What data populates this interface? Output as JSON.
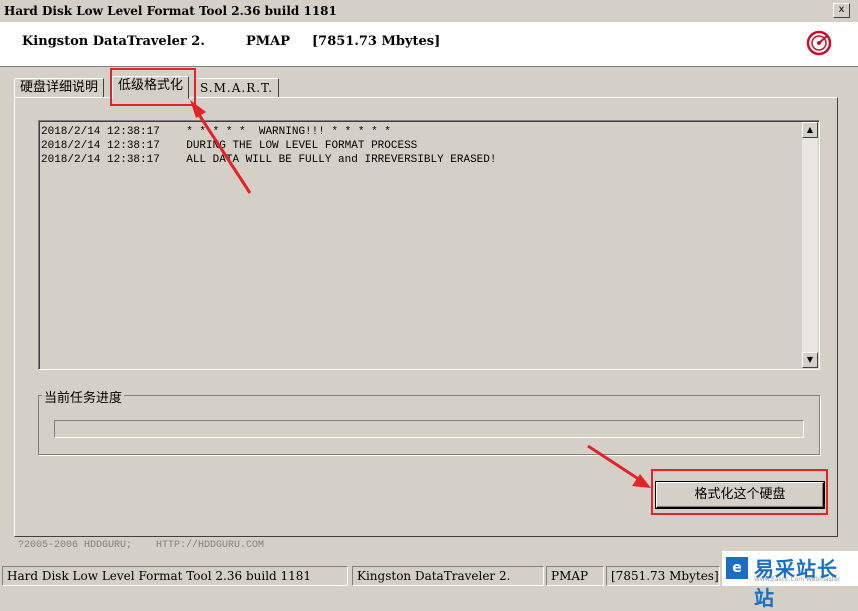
{
  "window": {
    "title": "Hard Disk Low Level Format Tool 2.36 build 1181",
    "close_glyph": "x"
  },
  "header": {
    "device": "Kingston DataTraveler 2.",
    "mode": "PMAP",
    "size": "[7851.73 Mbytes]"
  },
  "tabs": [
    {
      "label": "硬盘详细说明",
      "active": false
    },
    {
      "label": "低级格式化",
      "active": true
    },
    {
      "label": "S.M.A.R.T.",
      "active": false
    }
  ],
  "log": {
    "lines": [
      {
        "time": "2018/2/14 12:38:17",
        "text": "* * * * *  WARNING!!! * * * * *"
      },
      {
        "time": "2018/2/14 12:38:17",
        "text": "DURING THE LOW LEVEL FORMAT PROCESS"
      },
      {
        "time": "2018/2/14 12:38:17",
        "text": "ALL DATA WILL BE FULLY and IRREVERSIBLY ERASED!"
      }
    ]
  },
  "progress": {
    "label": "当前任务进度",
    "value": 0
  },
  "buttons": {
    "format_label": "格式化这个硬盘"
  },
  "footer": {
    "copyright": "?2005-2006 HDDGURU;    HTTP://HDDGURU.COM"
  },
  "statusbar": {
    "program": "Hard Disk Low Level Format Tool 2.36 build 1181",
    "device": "Kingston DataTraveler 2.",
    "mode": "PMAP",
    "size": "[7851.73 Mbytes]"
  },
  "watermark": {
    "text": "易采站长站",
    "sub": "Www.Easck.Com Webmaster"
  },
  "colors": {
    "highlight": "#e5222a",
    "face": "#d4d0c8"
  }
}
